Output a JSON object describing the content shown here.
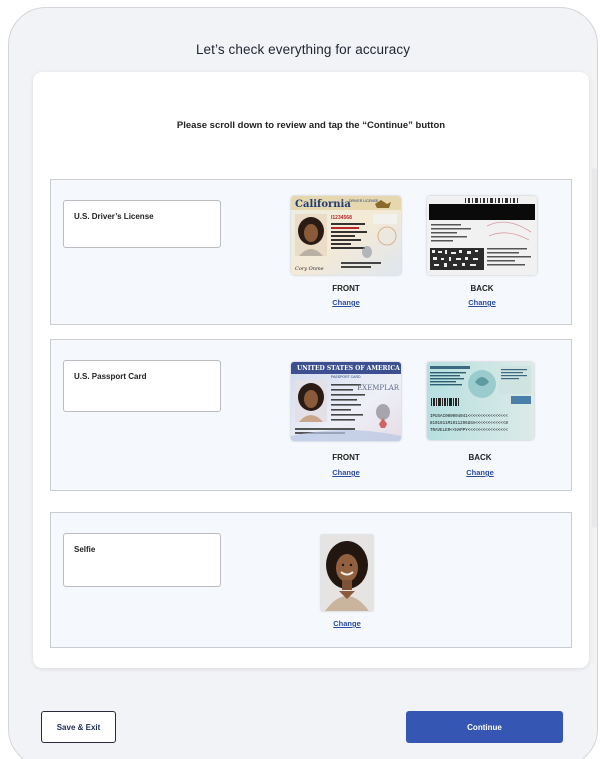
{
  "header": {
    "title": "Let’s check everything for accuracy"
  },
  "review": {
    "instructions": "Please scroll down to review and tap the “Continue” button",
    "sections": [
      {
        "label": "U.S. Driver’s License",
        "front_label": "FRONT",
        "back_label": "BACK",
        "change_front": "Change",
        "change_back": "Change",
        "front_card": {
          "state": "California",
          "header": "DRIVER LICENSE",
          "number": "I1234568",
          "signature": "Cory Onme"
        }
      },
      {
        "label": "U.S. Passport Card",
        "front_label": "FRONT",
        "back_label": "BACK",
        "change_front": "Change",
        "change_back": "Change",
        "front_card": {
          "country": "UNITED STATES OF AMERICA",
          "header": "PASSPORT CARD",
          "stamp": "EXEMPLAR"
        },
        "back_card": {
          "mrz_1": "IPUSAC000004041<<<<<<<<<<<<<<<<",
          "mrz_2": "8101011M1911296USA<<<<<<<<<<<<8",
          "mrz_3": "TRAVELER<<HAPPY<<<<<<<<<<<<<<<<"
        }
      },
      {
        "label": "Selfie",
        "change": "Change"
      }
    ]
  },
  "footer": {
    "save_exit": "Save & Exit",
    "continue": "Continue"
  },
  "colors": {
    "primary": "#3556b2",
    "link": "#2c4c9e",
    "section_bg": "#f5f8fd",
    "page_bg": "#f2f3f6"
  }
}
